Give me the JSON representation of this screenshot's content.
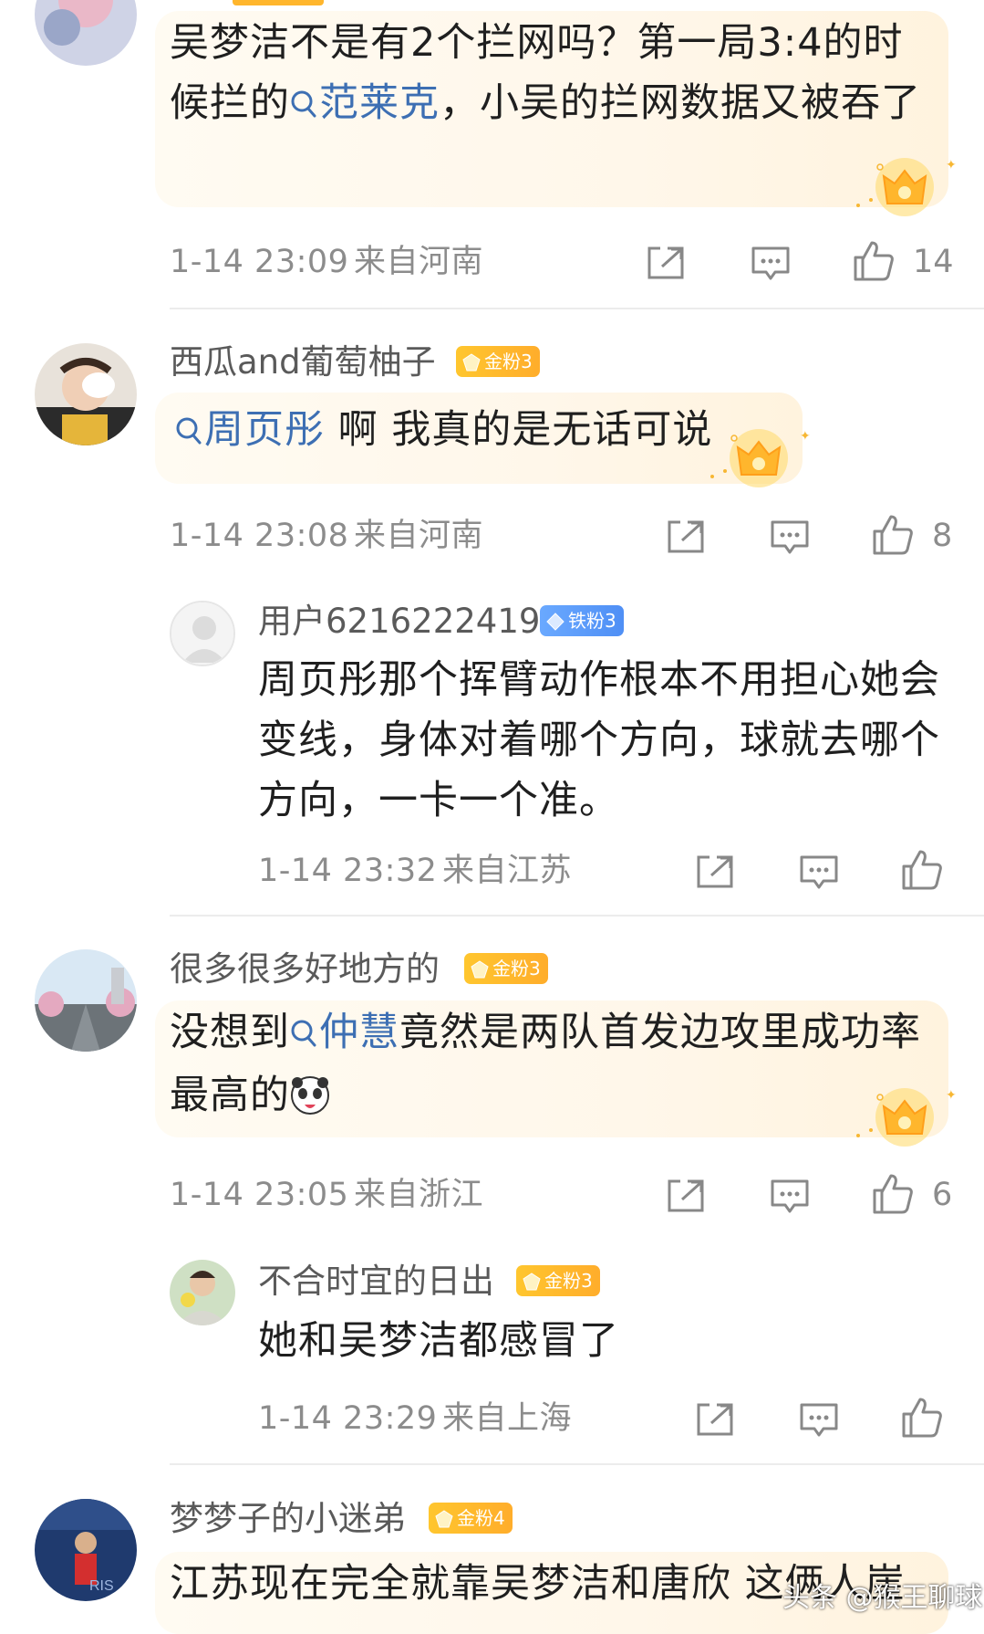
{
  "comments": [
    {
      "content_prefix": "吴梦洁不是有2个拦网吗？第一局3:4的时候拦的",
      "topic": "范莱克",
      "content_suffix": "，小吴的拦网数据又被吞了",
      "time": "1-14 23:09",
      "location": "来自河南",
      "likes": "14"
    },
    {
      "username": "西瓜and葡萄柚子",
      "badge": "金粉3",
      "topic": "周页彤",
      "content_suffix": "啊 我真的是无话可说",
      "time": "1-14 23:08",
      "location": "来自河南",
      "likes": "8",
      "reply": {
        "username": "用户6216222419",
        "badge": "铁粉3",
        "content": "周页彤那个挥臂动作根本不用担心她会变线，身体对着哪个方向，球就去哪个方向，一卡一个准。",
        "time": "1-14 23:32",
        "location": "来自江苏"
      }
    },
    {
      "username": "很多很多好地方的",
      "badge": "金粉3",
      "content_prefix": "没想到",
      "topic": "仲慧",
      "content_suffix": "竟然是两队首发边攻里成功率最高的",
      "time": "1-14 23:05",
      "location": "来自浙江",
      "likes": "6",
      "reply": {
        "username": "不合时宜的日出",
        "badge": "金粉3",
        "content": "她和吴梦洁都感冒了",
        "time": "1-14 23:29",
        "location": "来自上海"
      }
    },
    {
      "username": "梦梦子的小迷弟",
      "badge": "金粉4",
      "content_prefix": "江苏现在完全就靠吴梦洁和唐欣 这俩人崖"
    }
  ],
  "watermark": "头条 @猴王聊球",
  "icons": {
    "share": "share-icon",
    "comment": "comment-icon",
    "like": "like-icon",
    "topic": "search-icon",
    "crown": "gold-crown-icon"
  },
  "colors": {
    "topic": "#3d6fb3",
    "gold_badge": "#ffb62d",
    "iron_badge": "#5b9bf8",
    "meta": "#8c8c8c"
  }
}
